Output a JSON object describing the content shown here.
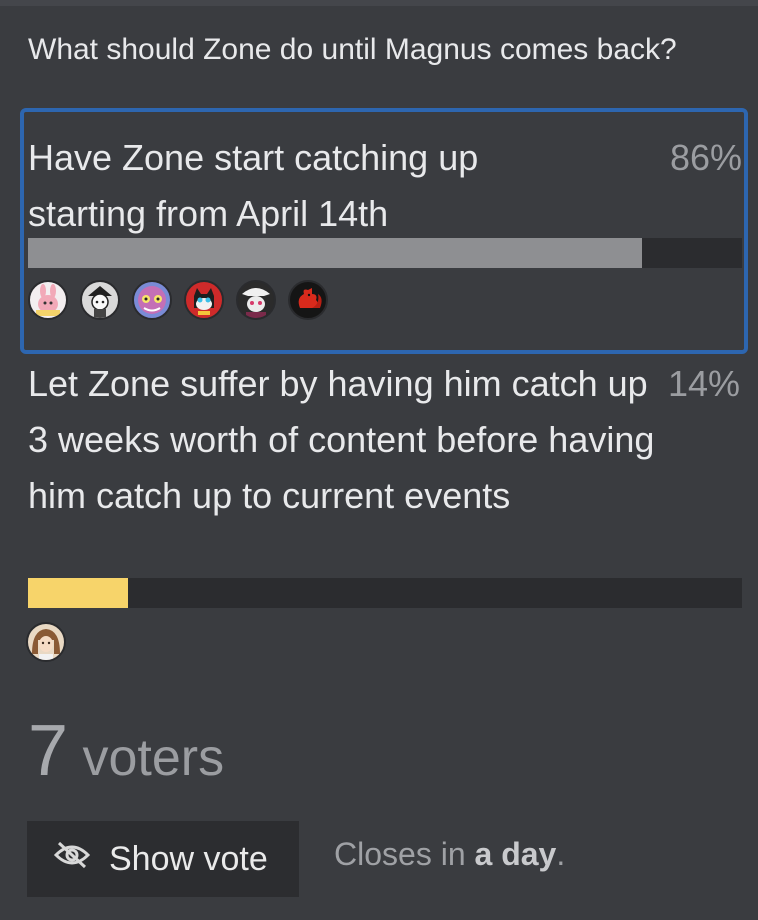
{
  "poll": {
    "question": "What should Zone do until Magnus comes back?",
    "options": [
      {
        "text": "Have Zone start catching up starting from April 14th",
        "percent_label": "86%",
        "percent": 86,
        "selected": true,
        "bar_color": "#8e8f92",
        "voter_avatars": [
          "pink-bunny-avatar",
          "monochrome-anime-avatar",
          "purple-cat-avatar",
          "morgana-cat-avatar",
          "masked-character-avatar",
          "red-squirrel-avatar"
        ]
      },
      {
        "text": "Let Zone suffer by having him catch up 3 weeks worth of content before having him catch up to current events",
        "percent_label": "14%",
        "percent": 14,
        "selected": false,
        "bar_color": "#f7d46a",
        "voter_avatars": [
          "brown-hair-girl-avatar"
        ]
      }
    ],
    "voter_count": "7",
    "voters_label": "voters",
    "show_vote_label": "Show vote",
    "closes_prefix": "Closes in",
    "closes_value": "a day",
    "closes_suffix": ".",
    "selected_border_color": "#2d66b0"
  }
}
